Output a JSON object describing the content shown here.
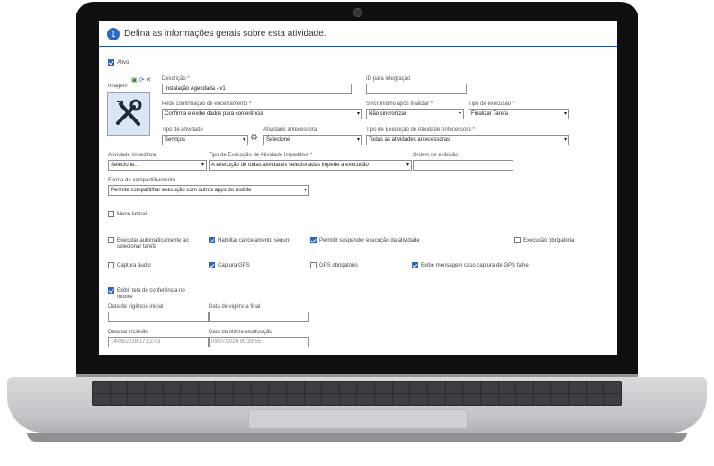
{
  "header": {
    "step": "1",
    "title": "Defina as informações gerais sobre esta atividade."
  },
  "ativo": {
    "label": "Ativo",
    "checked": true
  },
  "imagem": {
    "label": "Imagem",
    "icon": "tools-icon"
  },
  "descricao": {
    "label": "Descrição *",
    "value": "Instalação Agendada - v1"
  },
  "id_integracao": {
    "label": "ID para integração",
    "value": ""
  },
  "pede_confirmacao": {
    "label": "Pede confirmação de encerramento *",
    "value": "Confirma e exibe dados para conferência"
  },
  "sincronismo": {
    "label": "Sincronismo após finalizar *",
    "value": "Não sincronizar"
  },
  "tipo_execucao": {
    "label": "Tipo de execução *",
    "value": "Finalizar Tarefa"
  },
  "tipo_atividade": {
    "label": "Tipo de Atividade",
    "value": "Serviços"
  },
  "atividade_antecessora": {
    "label": "Atividade antecessora",
    "value": "Selecione"
  },
  "tipo_exec_antecessora": {
    "label": "Tipo de Execução de Atividade Antecessora *",
    "value": "Todas as atividades antecessoras"
  },
  "atividade_impeditiva": {
    "label": "Atividade impeditiva",
    "value": "Selecione..."
  },
  "tipo_exec_impeditiva": {
    "label": "Tipo de Execução de Atividade Impeditiva *",
    "value": "A execução de todas atividades selecionadas impede a execução"
  },
  "ordem_exibicao": {
    "label": "Ordem de exibição",
    "value": ""
  },
  "forma_compartilhamento": {
    "label": "Forma de compartilhamento",
    "value": "Permite compartilhar execução com outros apps do mobile"
  },
  "menu_lateral": {
    "label": "Menu lateral",
    "checked": false
  },
  "options_row1": [
    {
      "label": "Executar automaticamente ao selecionar tarefa",
      "checked": false
    },
    {
      "label": "Habilitar cancelamento seguro",
      "checked": true
    },
    {
      "label": "Permitir suspender execução da atividade",
      "checked": true
    },
    {
      "label": "Execução obrigatória",
      "checked": false
    }
  ],
  "options_row2": [
    {
      "label": "Captura áudio",
      "checked": false
    },
    {
      "label": "Captura GPS",
      "checked": true
    },
    {
      "label": "GPS obrigatório",
      "checked": false
    },
    {
      "label": "Exibe mensagem caso captura de GPS falhe",
      "checked": true
    }
  ],
  "exibir_tela": {
    "label": "Exibir tela de conferência no mobile",
    "checked": true
  },
  "vigencia_inicial": {
    "label": "Data de vigência inicial",
    "value": ""
  },
  "vigencia_final": {
    "label": "Data de vigência final",
    "value": ""
  },
  "data_inclusao": {
    "label": "Data da inclusão",
    "value": "14/09/2018 17:12:43"
  },
  "data_atualizacao": {
    "label": "Data da última atualização",
    "value": "09/07/2020 09:39:55"
  },
  "colors": {
    "accent": "#2f66c6",
    "header_line": "#1d4fa6"
  }
}
